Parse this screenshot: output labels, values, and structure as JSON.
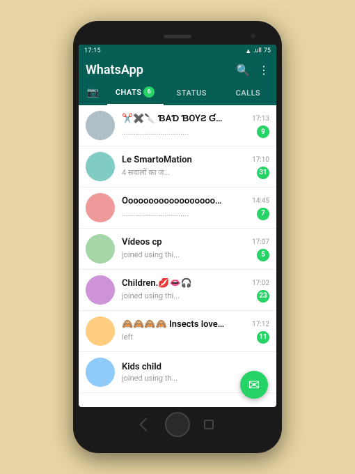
{
  "statusBar": {
    "time": "17:15",
    "indicators": "oo",
    "battery": "75",
    "signal": "▲▼ .ull"
  },
  "header": {
    "title": "WhatsApp",
    "searchLabel": "🔍",
    "menuLabel": "⋮"
  },
  "tabs": [
    {
      "id": "camera",
      "label": "📷",
      "type": "camera"
    },
    {
      "id": "chats",
      "label": "CHATS",
      "active": true,
      "badge": "6"
    },
    {
      "id": "status",
      "label": "STATUS",
      "active": false
    },
    {
      "id": "calls",
      "label": "CALLS",
      "active": false
    }
  ],
  "chats": [
    {
      "name": "✂️✖️🔪 ƁAƊ ƁOYƧ ƓANƓ...",
      "preview": ".................................",
      "time": "17:13",
      "unread": "9",
      "avatarColor": "avatar-color-1"
    },
    {
      "name": "Le SmartoMation",
      "preview": "4 सवालों का ज...",
      "time": "17:10",
      "unread": "31",
      "avatarColor": "avatar-color-2"
    },
    {
      "name": "Ooooooooooooooooooooooo...",
      "preview": ".................................",
      "time": "14:45",
      "unread": "7",
      "avatarColor": "avatar-color-3"
    },
    {
      "name": "Vídeos  cp",
      "preview": "joined using thi...",
      "time": "17:07",
      "unread": "5",
      "avatarColor": "avatar-color-4"
    },
    {
      "name": "Children.💋👄🎧",
      "preview": "joined using thi...",
      "time": "17:02",
      "unread": "23",
      "avatarColor": "avatar-color-5"
    },
    {
      "name": "🙈🙈🙈🙈 Insects lover🙈🙈...",
      "preview": "left",
      "time": "17:12",
      "unread": "11",
      "avatarColor": "avatar-color-6"
    },
    {
      "name": "Kids child",
      "preview": "joined using th...",
      "time": "",
      "unread": "",
      "avatarColor": "avatar-color-7"
    }
  ],
  "fab": {
    "icon": "💬"
  }
}
